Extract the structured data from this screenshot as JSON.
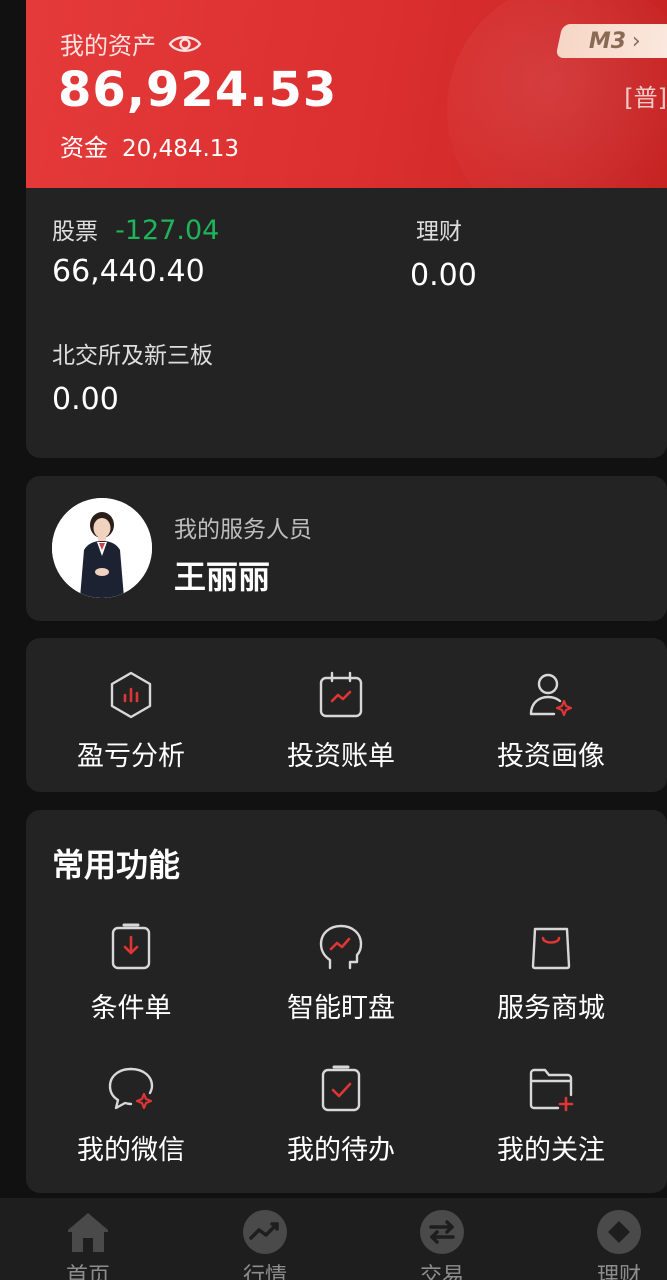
{
  "asset": {
    "title": "我的资产",
    "total": "86,924.53",
    "cash_label": "资金",
    "cash_value": "20,484.13",
    "level": "M3",
    "account_type": "[普]"
  },
  "holdings": [
    {
      "label": "股票",
      "change": "-127.04",
      "value": "66,440.40"
    },
    {
      "label": "理财",
      "value": "0.00"
    },
    {
      "label": "北交所及新三板",
      "value": "0.00"
    }
  ],
  "advisor": {
    "role": "我的服务人员",
    "name": "王丽丽"
  },
  "analysis": [
    {
      "label": "盈亏分析",
      "icon": "profit-analysis-icon"
    },
    {
      "label": "投资账单",
      "icon": "investment-bill-icon"
    },
    {
      "label": "投资画像",
      "icon": "investment-profile-icon"
    }
  ],
  "common": {
    "title": "常用功能",
    "items": [
      {
        "label": "条件单",
        "icon": "conditional-order-icon"
      },
      {
        "label": "智能盯盘",
        "icon": "smart-watch-icon"
      },
      {
        "label": "服务商城",
        "icon": "service-mall-icon"
      },
      {
        "label": "我的微信",
        "icon": "wechat-icon"
      },
      {
        "label": "我的待办",
        "icon": "todo-icon"
      },
      {
        "label": "我的关注",
        "icon": "follow-folder-icon"
      }
    ]
  },
  "nav": [
    {
      "label": "首页",
      "icon": "home-icon"
    },
    {
      "label": "行情",
      "icon": "market-icon"
    },
    {
      "label": "交易",
      "icon": "trade-icon"
    },
    {
      "label": "理财",
      "icon": "wealth-icon"
    }
  ],
  "colors": {
    "brand_red": "#e03535",
    "up_green": "#1fb35a",
    "card_bg": "#232323",
    "page_bg": "#111111"
  }
}
